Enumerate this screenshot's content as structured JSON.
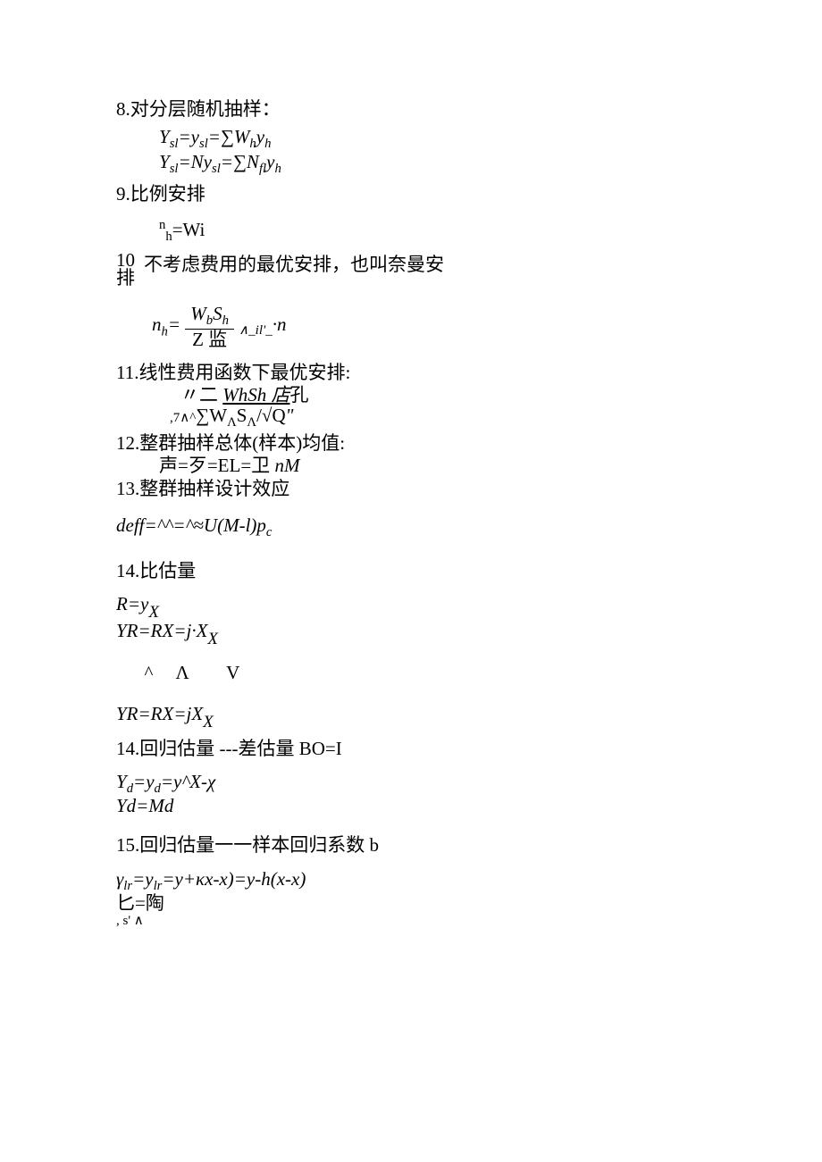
{
  "items": {
    "i8": {
      "num": "8",
      "sep": " . ",
      "title": "对分层随机抽样：",
      "formula1_pre": "Y",
      "formula1_sub1": "sl",
      "formula1_eq1": "=y",
      "formula1_sub2": "sl",
      "formula1_eq2": "=∑W",
      "formula1_sub3": "h",
      "formula1_eq3": "y",
      "formula1_sub4": "h",
      "formula2_pre": "Y",
      "formula2_sub1": "sl",
      "formula2_eq1": "=Ny",
      "formula2_sub2": "sl",
      "formula2_eq2": "=∑N",
      "formula2_sub3": "fl",
      "formula2_eq3": "y",
      "formula2_sub4": "h"
    },
    "i9": {
      "num": "9",
      "sep": " .",
      "title": "比例安排",
      "f_sup": "n",
      "f_sub": "h",
      "f_eq": "=Wi"
    },
    "i10": {
      "num": "10",
      "sep": "",
      "title": "不考虑费用的最优安排，也叫奈曼安",
      "title2": "排",
      "f_pre": "n",
      "f_presub": "h",
      "num_top_pre": "W",
      "num_top_sub": "b",
      "num_top_post": "S",
      "num_top_sub2": "h",
      "den_bot": "Z 监",
      "mid": "∧_il'_",
      "post": "·n"
    },
    "i11": {
      "num": "11",
      "sep": " .",
      "title": "线性费用函数下最优安排:",
      "l1_a": "〃二 ",
      "l1_b": "WhSh 店",
      "l1_c": "孔",
      "l2_a": ",7∧^",
      "l2_b": "∑W",
      "l2_sub1": "Λ",
      "l2_c": "S",
      "l2_sub2": "Λ",
      "l2_d": "/√Q",
      "l2_e": "\""
    },
    "i12": {
      "num": "12",
      "sep": " .",
      "title": "整群抽样总体(样本)均值:",
      "l1": "声=歹=EL=卫 ",
      "l1_it": "nM"
    },
    "i13": {
      "num": "13",
      "sep": " .",
      "title": "整群抽样设计效应",
      "f": "deff=^^=^≈U(M-l)p",
      "f_sub": "c"
    },
    "i14": {
      "num": "14",
      "sep": " . ",
      "title": "比估量",
      "l1a": "R=y",
      "l1b": "X",
      "l2a": "YR=RX=j·X",
      "l2b": "X",
      "l3": "^     Λ        V",
      "l4a": "YR=RX=jX",
      "l4b": "X"
    },
    "i14b": {
      "num": "14",
      "sep": " .",
      "title": "回归估量 ---差估量 BO=I",
      "l1a": "Y",
      "l1sub": "d",
      "l1b": "=y",
      "l1sub2": "d",
      "l1c": "=y^X-χ",
      "l2": "Yd=Md"
    },
    "i15": {
      "num": "15",
      "sep": " .",
      "title": "回归估量一一样本回归系数 b",
      "l1a": "γ",
      "l1sub1": "lr",
      "l1b": "=y",
      "l1sub2": "lr",
      "l1c": "=y+κx-x)=y-h(x-x)",
      "l2": "匕=陶",
      "l3": ", s' ∧"
    }
  }
}
